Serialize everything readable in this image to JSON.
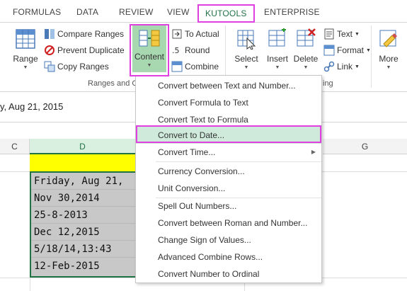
{
  "tabs": [
    "FORMULAS",
    "DATA",
    "REVIEW",
    "VIEW",
    "KUTOOLS",
    "ENTERPRISE"
  ],
  "active_tab": "KUTOOLS",
  "ribbon": {
    "range": "Range",
    "compare_ranges": "Compare Ranges",
    "prevent_duplicate": "Prevent Duplicate",
    "copy_ranges": "Copy Ranges",
    "content": "Content",
    "to_actual": "To Actual",
    "round": "Round",
    "combine": "Combine",
    "group_label": "Ranges and C",
    "select": "Select",
    "insert": "Insert",
    "delete": "Delete",
    "text": "Text",
    "format": "Format",
    "link": "Link",
    "more": "More",
    "group_label_right": "ing"
  },
  "formula_bar": {
    "value": "y, Aug 21, 2015"
  },
  "columns": {
    "c": "C",
    "d": "D",
    "g": "G"
  },
  "cells": [
    "Friday, Aug 21,",
    "Nov 30,2014",
    "25-8-2013",
    "Dec 12,2015",
    "5/18/14,13:43",
    "12-Feb-2015"
  ],
  "menu": {
    "items": [
      "Convert between Text and Number...",
      "Convert Formula to Text",
      "Convert Text to Formula",
      "Convert to Date...",
      "Convert Time...",
      "Currency Conversion...",
      "Unit Conversion...",
      "Spell Out Numbers...",
      "Convert between Roman and Number...",
      "Change Sign of Values...",
      "Advanced Combine Rows...",
      "Convert Number to Ordinal"
    ],
    "highlighted": "Convert to Date..."
  },
  "colors": {
    "excel_green": "#217346",
    "highlight_box": "#e040e0",
    "menu_highlight": "#cfeadb",
    "yellow_cell": "#ffff00",
    "content_button_bg": "#a8d8b0"
  },
  "icons": {
    "range": "range-grid-icon",
    "compare": "compare-ranges-icon",
    "prevent": "prevent-duplicate-icon",
    "copy": "copy-ranges-icon",
    "content": "content-icon",
    "to_actual": "to-actual-icon",
    "round": "round-icon",
    "combine": "combine-icon",
    "select": "select-icon",
    "insert": "insert-icon",
    "delete": "delete-icon",
    "text": "text-icon",
    "format": "format-icon",
    "link": "link-icon",
    "more": "more-icon"
  }
}
